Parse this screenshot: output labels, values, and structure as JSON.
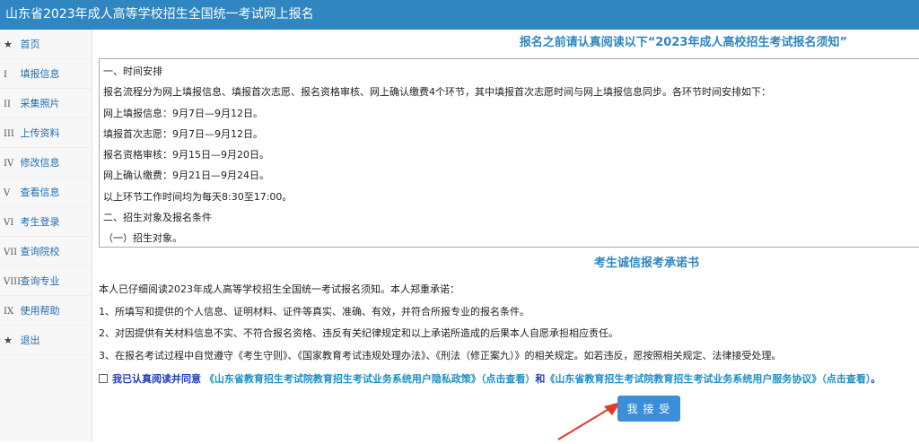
{
  "header": {
    "title": "山东省2023年成人高等学校招生全国统一考试网上报名"
  },
  "sidebar": {
    "items": [
      {
        "mark": "★",
        "label": "首页"
      },
      {
        "mark": "I",
        "label": "填报信息"
      },
      {
        "mark": "II",
        "label": "采集照片"
      },
      {
        "mark": "III",
        "label": "上传资料"
      },
      {
        "mark": "IV",
        "label": "修改信息"
      },
      {
        "mark": "V",
        "label": "查看信息"
      },
      {
        "mark": "VI",
        "label": "考生登录"
      },
      {
        "mark": "VII",
        "label": "查询院校"
      },
      {
        "mark": "VIII",
        "label": "查询专业"
      },
      {
        "mark": "IX",
        "label": "使用帮助"
      },
      {
        "mark": "★",
        "label": "退出"
      }
    ]
  },
  "main": {
    "notice_title": "报名之前请认真阅读以下“2023年成人高校招生考试报名须知”",
    "notice_lines": [
      "一、时间安排",
      "报名流程分为网上填报信息、填报首次志愿、报名资格审核、网上确认缴费4个环节，其中填报首次志愿时间与网上填报信息同步。各环节时间安排如下：",
      "网上填报信息：9月7日—9月12日。",
      "填报首次志愿：9月7日—9月12日。",
      "报名资格审核：9月15日—9月20日。",
      "网上确认缴费：9月21日—9月24日。",
      "以上环节工作时间均为每天8:30至17:00。",
      "二、招生对象及报名条件",
      "（一）招生对象。"
    ],
    "pledge_title": "考生诚信报考承诺书",
    "pledge_lines": [
      "本人已仔细阅读2023年成人高等学校招生全国统一考试报名须知。本人郑重承诺：",
      "1、所填写和提供的个人信息、证明材料、证件等真实、准确、有效，并符合所报专业的报名条件。",
      "2、对因提供有关材料信息不实、不符合报名资格、违反有关纪律规定和以上承诺所造成的后果本人自愿承担相应责任。",
      "3、在报名考试过程中自觉遵守《考生守则》、《国家教育考试违规处理办法》、《刑法（修正案九）》的相关规定。如若违反，愿按照相关规定、法律接受处理。"
    ],
    "agree": {
      "prefix": "我已认真阅读并同意",
      "privacy_link": "《山东省教育招生考试院教育招生考试业务系统用户隐私政策》（点击查看）",
      "and": "和",
      "service_link": "《山东省教育招生考试院教育招生考试业务系统用户服务协议》（点击查看）",
      "suffix": "。"
    },
    "accept_button": "我 接 受"
  },
  "colors": {
    "header_bg": "#2f86c0",
    "button_bg": "#3d8ed8",
    "arrow": "#e23a2a"
  }
}
